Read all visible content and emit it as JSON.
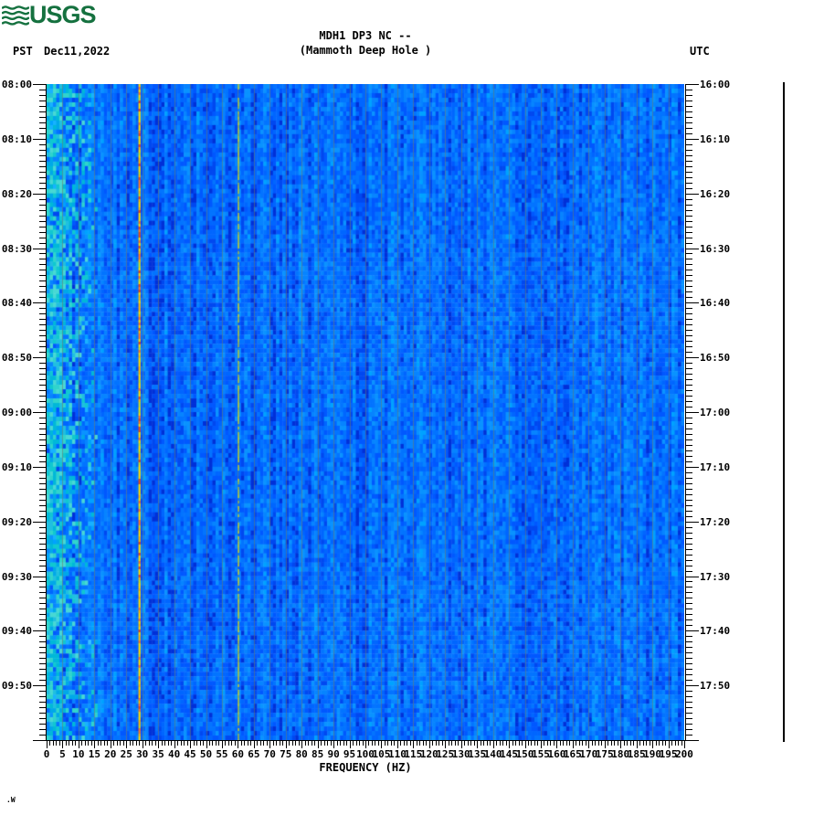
{
  "logo": {
    "text": "USGS",
    "color": "#15713f",
    "icon": "usgs-wave-icon"
  },
  "header": {
    "timezone_left": "PST",
    "date": "Dec11,2022",
    "title_line1": "MDH1 DP3 NC --",
    "title_line2": "(Mammoth Deep Hole )",
    "timezone_right": "UTC"
  },
  "chart_data": {
    "type": "heatmap",
    "subtype": "seismic spectrogram",
    "title": "MDH1 DP3 NC --",
    "subtitle": "(Mammoth Deep Hole )",
    "station": "MDH1 DP3 NC",
    "site_name": "Mammoth Deep Hole",
    "date": "Dec11,2022",
    "xlabel": "FREQUENCY (HZ)",
    "x_axis": {
      "min_hz": 0,
      "max_hz": 200,
      "major_tick_step_hz": 5,
      "minor_tick_step_hz": 1,
      "tick_labels": [
        "0",
        "5",
        "10",
        "15",
        "20",
        "25",
        "30",
        "35",
        "40",
        "45",
        "50",
        "55",
        "60",
        "65",
        "70",
        "75",
        "80",
        "85",
        "90",
        "95",
        "100",
        "105",
        "110",
        "115",
        "120",
        "125",
        "130",
        "135",
        "140",
        "145",
        "150",
        "155",
        "160",
        "165",
        "170",
        "175",
        "180",
        "185",
        "190",
        "195",
        "200"
      ]
    },
    "y_axis_left": {
      "timezone": "PST",
      "start": "08:00",
      "end": "10:00",
      "major_tick_step_min": 10,
      "minor_tick_step_min": 1,
      "tick_labels": [
        "08:00",
        "08:10",
        "08:20",
        "08:30",
        "08:40",
        "08:50",
        "09:00",
        "09:10",
        "09:20",
        "09:30",
        "09:40",
        "09:50"
      ]
    },
    "y_axis_right": {
      "timezone": "UTC",
      "start": "16:00",
      "end": "18:00",
      "major_tick_step_min": 10,
      "minor_tick_step_min": 1,
      "tick_labels": [
        "16:00",
        "16:10",
        "16:20",
        "16:30",
        "16:40",
        "16:50",
        "17:00",
        "17:10",
        "17:20",
        "17:30",
        "17:40",
        "17:50"
      ]
    },
    "legend": "none",
    "grid": "vertical gridlines every 5 Hz",
    "gridline_color": "#6e7a64",
    "background_palette": [
      "#0030d8",
      "#0048f0",
      "#0058ff",
      "#0066ff",
      "#0374ff",
      "#0784ff",
      "#0a93ff",
      "#00a2ff",
      "#18b2ff",
      "#38c4ff"
    ],
    "low_freq_palette": [
      "#00b8d8",
      "#10c8d0",
      "#30d4cc",
      "#00a8e8",
      "#48d8d4",
      "#20bfe0"
    ],
    "features": [
      {
        "name": "broadband-low-frequency-energy",
        "range_hz": [
          0,
          16
        ],
        "appearance": "light cyan band strongest near 0 Hz, persists full record"
      },
      {
        "name": "narrowband-tonal-line",
        "freq_hz": 29,
        "appearance": "bright yellow/orange vertical line, persists full record",
        "colors": [
          "#ffd800",
          "#ff9000",
          "#ff5030"
        ]
      },
      {
        "name": "powerline-noise-line",
        "freq_hz": 60,
        "appearance": "dim yellow-green vertical line, persists full record",
        "colors": [
          "#b8cc38"
        ]
      }
    ]
  },
  "scale_bar": {
    "description": "unlabeled vertical black line right of plot",
    "color": "#000000"
  },
  "footer": {
    "note": ".W"
  },
  "colors": {
    "background": "#ffffff",
    "text": "#000000",
    "logo_green": "#15713f"
  }
}
